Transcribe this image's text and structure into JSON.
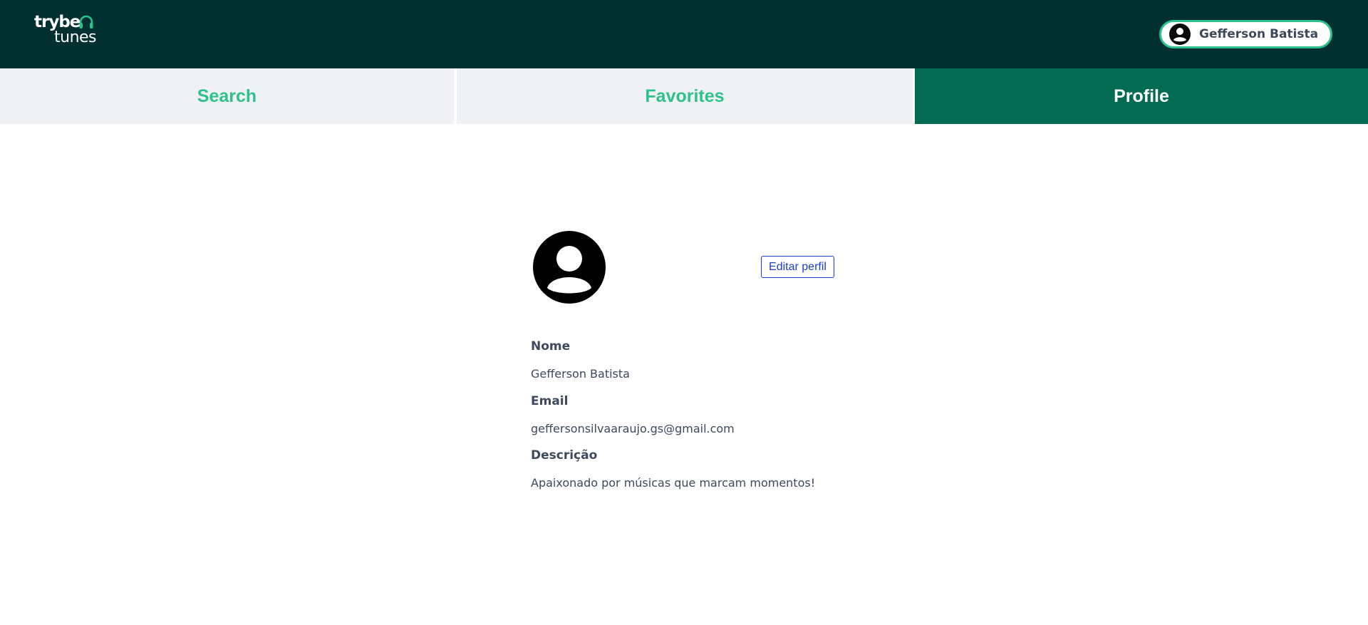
{
  "header": {
    "logo": {
      "line1": "trybe",
      "line2": "tunes",
      "icon": "headphones-icon"
    },
    "user": {
      "name": "Gefferson Batista",
      "avatar_icon": "user-circle-icon"
    }
  },
  "nav": {
    "tabs": [
      {
        "label": "Search",
        "active": false
      },
      {
        "label": "Favorites",
        "active": false
      },
      {
        "label": "Profile",
        "active": true
      }
    ]
  },
  "profile": {
    "avatar_icon": "user-circle-icon",
    "edit_label": "Editar perfil",
    "fields": [
      {
        "label": "Nome",
        "value": "Gefferson Batista"
      },
      {
        "label": "Email",
        "value": "geffersonsilvaaraujo.gs@gmail.com"
      },
      {
        "label": "Descrição",
        "value": "Apaixonado por músicas que marcam momentos!"
      }
    ]
  },
  "colors": {
    "header_bg": "#023031",
    "accent_green": "#2fc18c",
    "active_tab_bg": "#036b52",
    "tab_bg": "#eff1f5",
    "text": "#3d495c",
    "edit_button": "#1b3fc6"
  }
}
